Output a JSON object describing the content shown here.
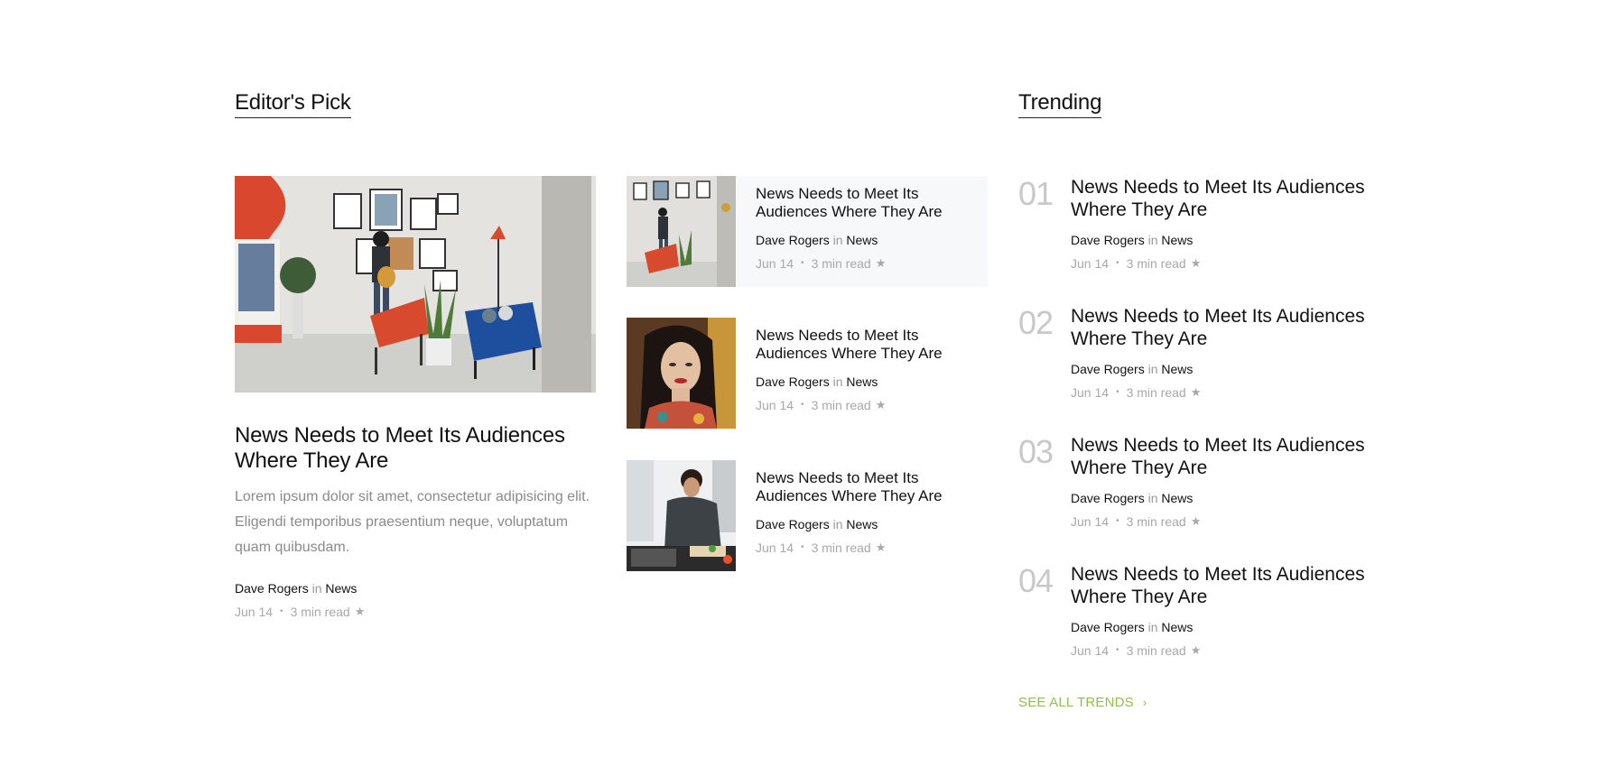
{
  "editors_pick": {
    "heading": "Editor's Pick",
    "featured": {
      "title": "News Needs to Meet Its Audiences Where They Are",
      "excerpt": "Lorem ipsum dolor sit amet, consectetur adipisicing elit. Eligendi temporibus praesentium neque, voluptatum quam quibusdam.",
      "author": "Dave Rogers",
      "in_word": "in",
      "category": "News",
      "date": "Jun 14",
      "separator": "•",
      "read_time": "3 min read",
      "star": "★"
    },
    "list": [
      {
        "title": "News Needs to Meet Its Audiences Where They Are",
        "author": "Dave Rogers",
        "in_word": "in",
        "category": "News",
        "date": "Jun 14",
        "separator": "•",
        "read_time": "3 min read",
        "star": "★",
        "image": "gallery-photo"
      },
      {
        "title": "News Needs to Meet Its Audiences Where They Are",
        "author": "Dave Rogers",
        "in_word": "in",
        "category": "News",
        "date": "Jun 14",
        "separator": "•",
        "read_time": "3 min read",
        "star": "★",
        "image": "portrait-photo"
      },
      {
        "title": "News Needs to Meet Its Audiences Where They Are",
        "author": "Dave Rogers",
        "in_word": "in",
        "category": "News",
        "date": "Jun 14",
        "separator": "•",
        "read_time": "3 min read",
        "star": "★",
        "image": "chef-photo"
      }
    ]
  },
  "trending": {
    "heading": "Trending",
    "items": [
      {
        "num": "01",
        "title": "News Needs to Meet Its Audiences Where They Are",
        "author": "Dave Rogers",
        "in_word": "in",
        "category": "News",
        "date": "Jun 14",
        "separator": "•",
        "read_time": "3 min read",
        "star": "★"
      },
      {
        "num": "02",
        "title": "News Needs to Meet Its Audiences Where They Are",
        "author": "Dave Rogers",
        "in_word": "in",
        "category": "News",
        "date": "Jun 14",
        "separator": "•",
        "read_time": "3 min read",
        "star": "★"
      },
      {
        "num": "03",
        "title": "News Needs to Meet Its Audiences Where They Are",
        "author": "Dave Rogers",
        "in_word": "in",
        "category": "News",
        "date": "Jun 14",
        "separator": "•",
        "read_time": "3 min read",
        "star": "★"
      },
      {
        "num": "04",
        "title": "News Needs to Meet Its Audiences Where They Are",
        "author": "Dave Rogers",
        "in_word": "in",
        "category": "News",
        "date": "Jun 14",
        "separator": "•",
        "read_time": "3 min read",
        "star": "★"
      }
    ],
    "see_all": "SEE ALL TRENDS",
    "see_all_chevron": "›"
  },
  "colors": {
    "accent_green": "#8fc04a",
    "muted_text": "#a8a8a8",
    "highlight_bg": "#f7f8f9"
  }
}
